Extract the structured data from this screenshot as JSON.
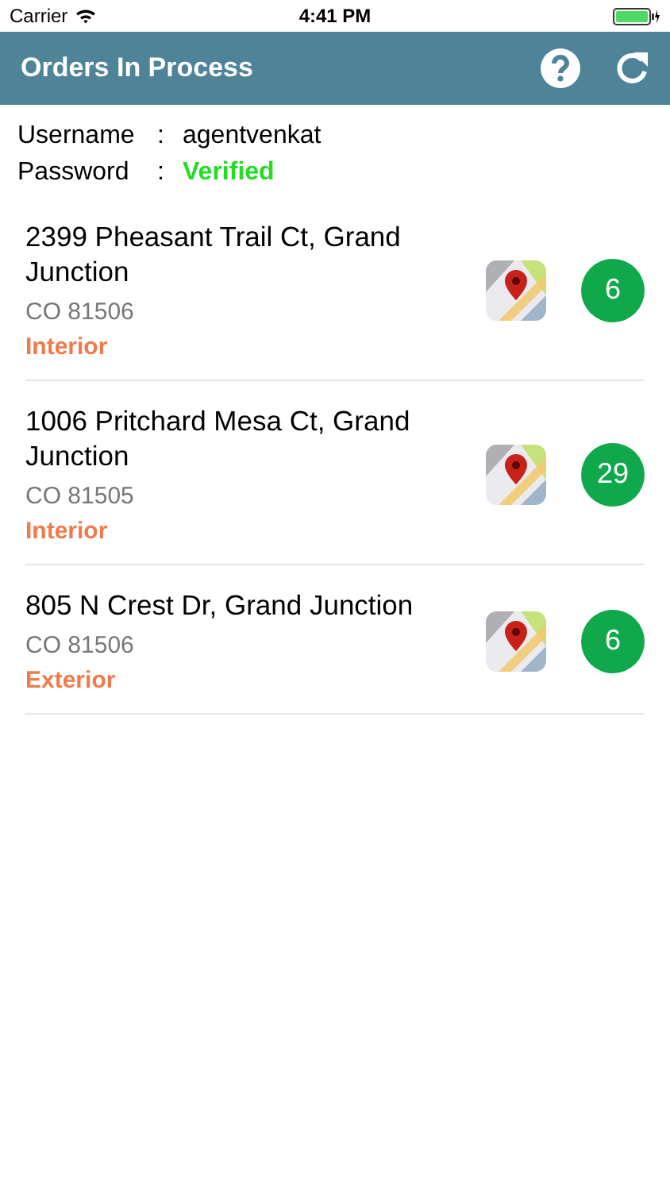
{
  "status_bar": {
    "carrier": "Carrier",
    "time": "4:41 PM"
  },
  "nav_bar": {
    "title": "Orders In Process"
  },
  "account": [
    {
      "label": "Username",
      "separator": ":",
      "value": "agentvenkat",
      "kind": "plain"
    },
    {
      "label": "Password",
      "separator": ":",
      "value": "Verified",
      "kind": "status"
    }
  ],
  "orders": [
    {
      "address": "2399 Pheasant Trail Ct, Grand Junction",
      "zip": "CO 81506",
      "type": "Interior",
      "count": "6"
    },
    {
      "address": "1006 Pritchard Mesa Ct, Grand Junction",
      "zip": "CO 81505",
      "type": "Interior",
      "count": "29"
    },
    {
      "address": "805 N Crest Dr, Grand Junction",
      "zip": "CO 81506",
      "type": "Exterior",
      "count": "6"
    }
  ]
}
